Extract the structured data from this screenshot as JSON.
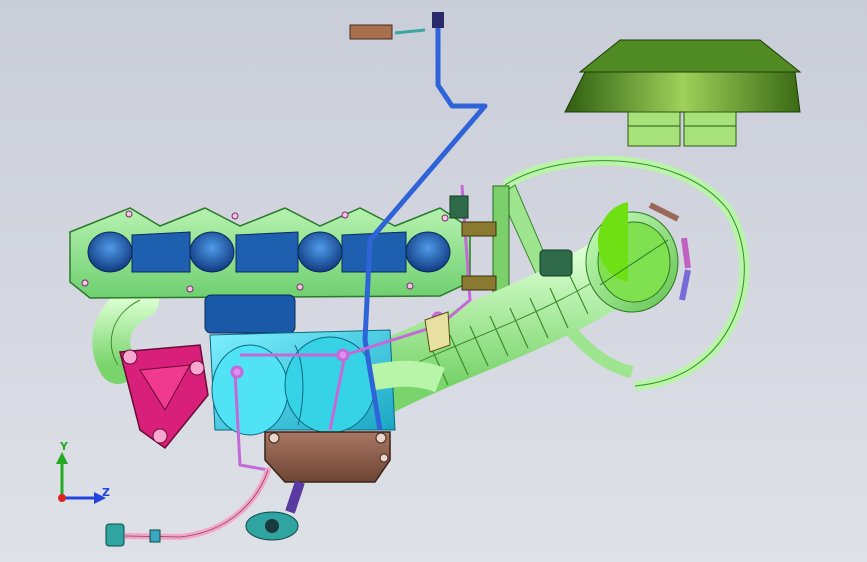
{
  "viewport": {
    "background_top": "#c9cdd8",
    "background_bottom": "#dfe1e8"
  },
  "model": {
    "parts": [
      {
        "name": "exhaust-manifold",
        "color": "#9be39a",
        "edge": "#2a7a2a"
      },
      {
        "name": "exhaust-ports",
        "color": "#1f5fb0"
      },
      {
        "name": "turbo-housing",
        "color": "#36d3e6"
      },
      {
        "name": "intake-hose",
        "color": "#b8f5a8"
      },
      {
        "name": "air-filter-cover",
        "color": "#3f7f1a"
      },
      {
        "name": "flange-bracket",
        "color": "#d8207a"
      },
      {
        "name": "actuator-box",
        "color": "#8a5a45"
      },
      {
        "name": "oil-line",
        "color": "#f2a6c6"
      },
      {
        "name": "coolant-line",
        "color": "#3a6ee0"
      },
      {
        "name": "purple-line",
        "color": "#c46ad8"
      }
    ]
  },
  "triad": {
    "y_label": "Y",
    "z_label": "Z",
    "y_color": "#22aa22",
    "z_color": "#2244dd",
    "x_color": "#dd2222"
  }
}
